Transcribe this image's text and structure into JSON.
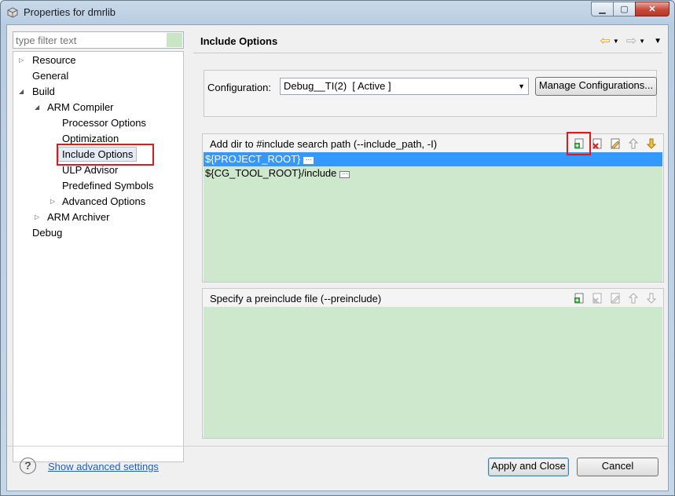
{
  "window": {
    "title": "Properties for dmrlib",
    "minimize": "▁",
    "maximize": "▢",
    "close": "✕"
  },
  "filter": {
    "placeholder": "type filter text"
  },
  "tree": {
    "resource": "Resource",
    "general": "General",
    "build": "Build",
    "arm_compiler": "ARM Compiler",
    "processor_options": "Processor Options",
    "optimization": "Optimization",
    "include_options": "Include Options",
    "ulp_advisor": "ULP Advisor",
    "predefined_symbols": "Predefined Symbols",
    "advanced_options": "Advanced Options",
    "arm_archiver": "ARM Archiver",
    "debug": "Debug"
  },
  "header": {
    "title": "Include Options"
  },
  "config": {
    "label": "Configuration:",
    "selected": "Debug__TI(2)  [ Active ]",
    "manage_button": "Manage Configurations..."
  },
  "include_path": {
    "title": "Add dir to #include search path (--include_path, -I)",
    "items": [
      "${PROJECT_ROOT}",
      "${CG_TOOL_ROOT}/include"
    ]
  },
  "preinclude": {
    "title": "Specify a preinclude file (--preinclude)"
  },
  "footer": {
    "help": "?",
    "advanced_link": "Show advanced settings",
    "apply_close": "Apply and Close",
    "cancel": "Cancel"
  },
  "colors": {
    "list_bg": "#cde8cd",
    "selection": "#3399ff",
    "highlight_box": "#e01a1a"
  }
}
